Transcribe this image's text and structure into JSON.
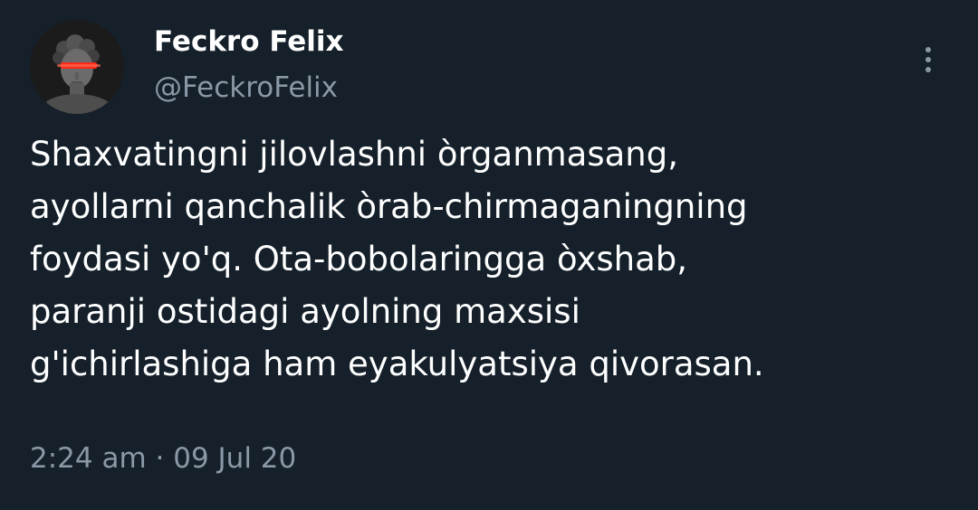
{
  "author": {
    "display_name": "Feckro Felix",
    "handle": "@FeckroFelix",
    "avatar_icon": "statue-head-red-visor-icon"
  },
  "tweet": {
    "text_lines": [
      "Shaxvatingni jilovlashni òrganmasang,",
      "ayollarni qanchalik òrab-chirmaganingning",
      "foydasi yo'q. Ota-bobolaringga òxshab,",
      "paranji ostidagi ayolning maxsisi",
      "g'ichirlashiga ham eyakulyatsiya qivorasan."
    ],
    "timestamp": "2:24 am · 09 Jul 20"
  },
  "menu": {
    "icon": "more-vertical-icon"
  },
  "colors": {
    "background": "#15202b",
    "text_primary": "#ffffff",
    "text_secondary": "#8b98a5",
    "avatar_visor": "#ff2a1a"
  }
}
